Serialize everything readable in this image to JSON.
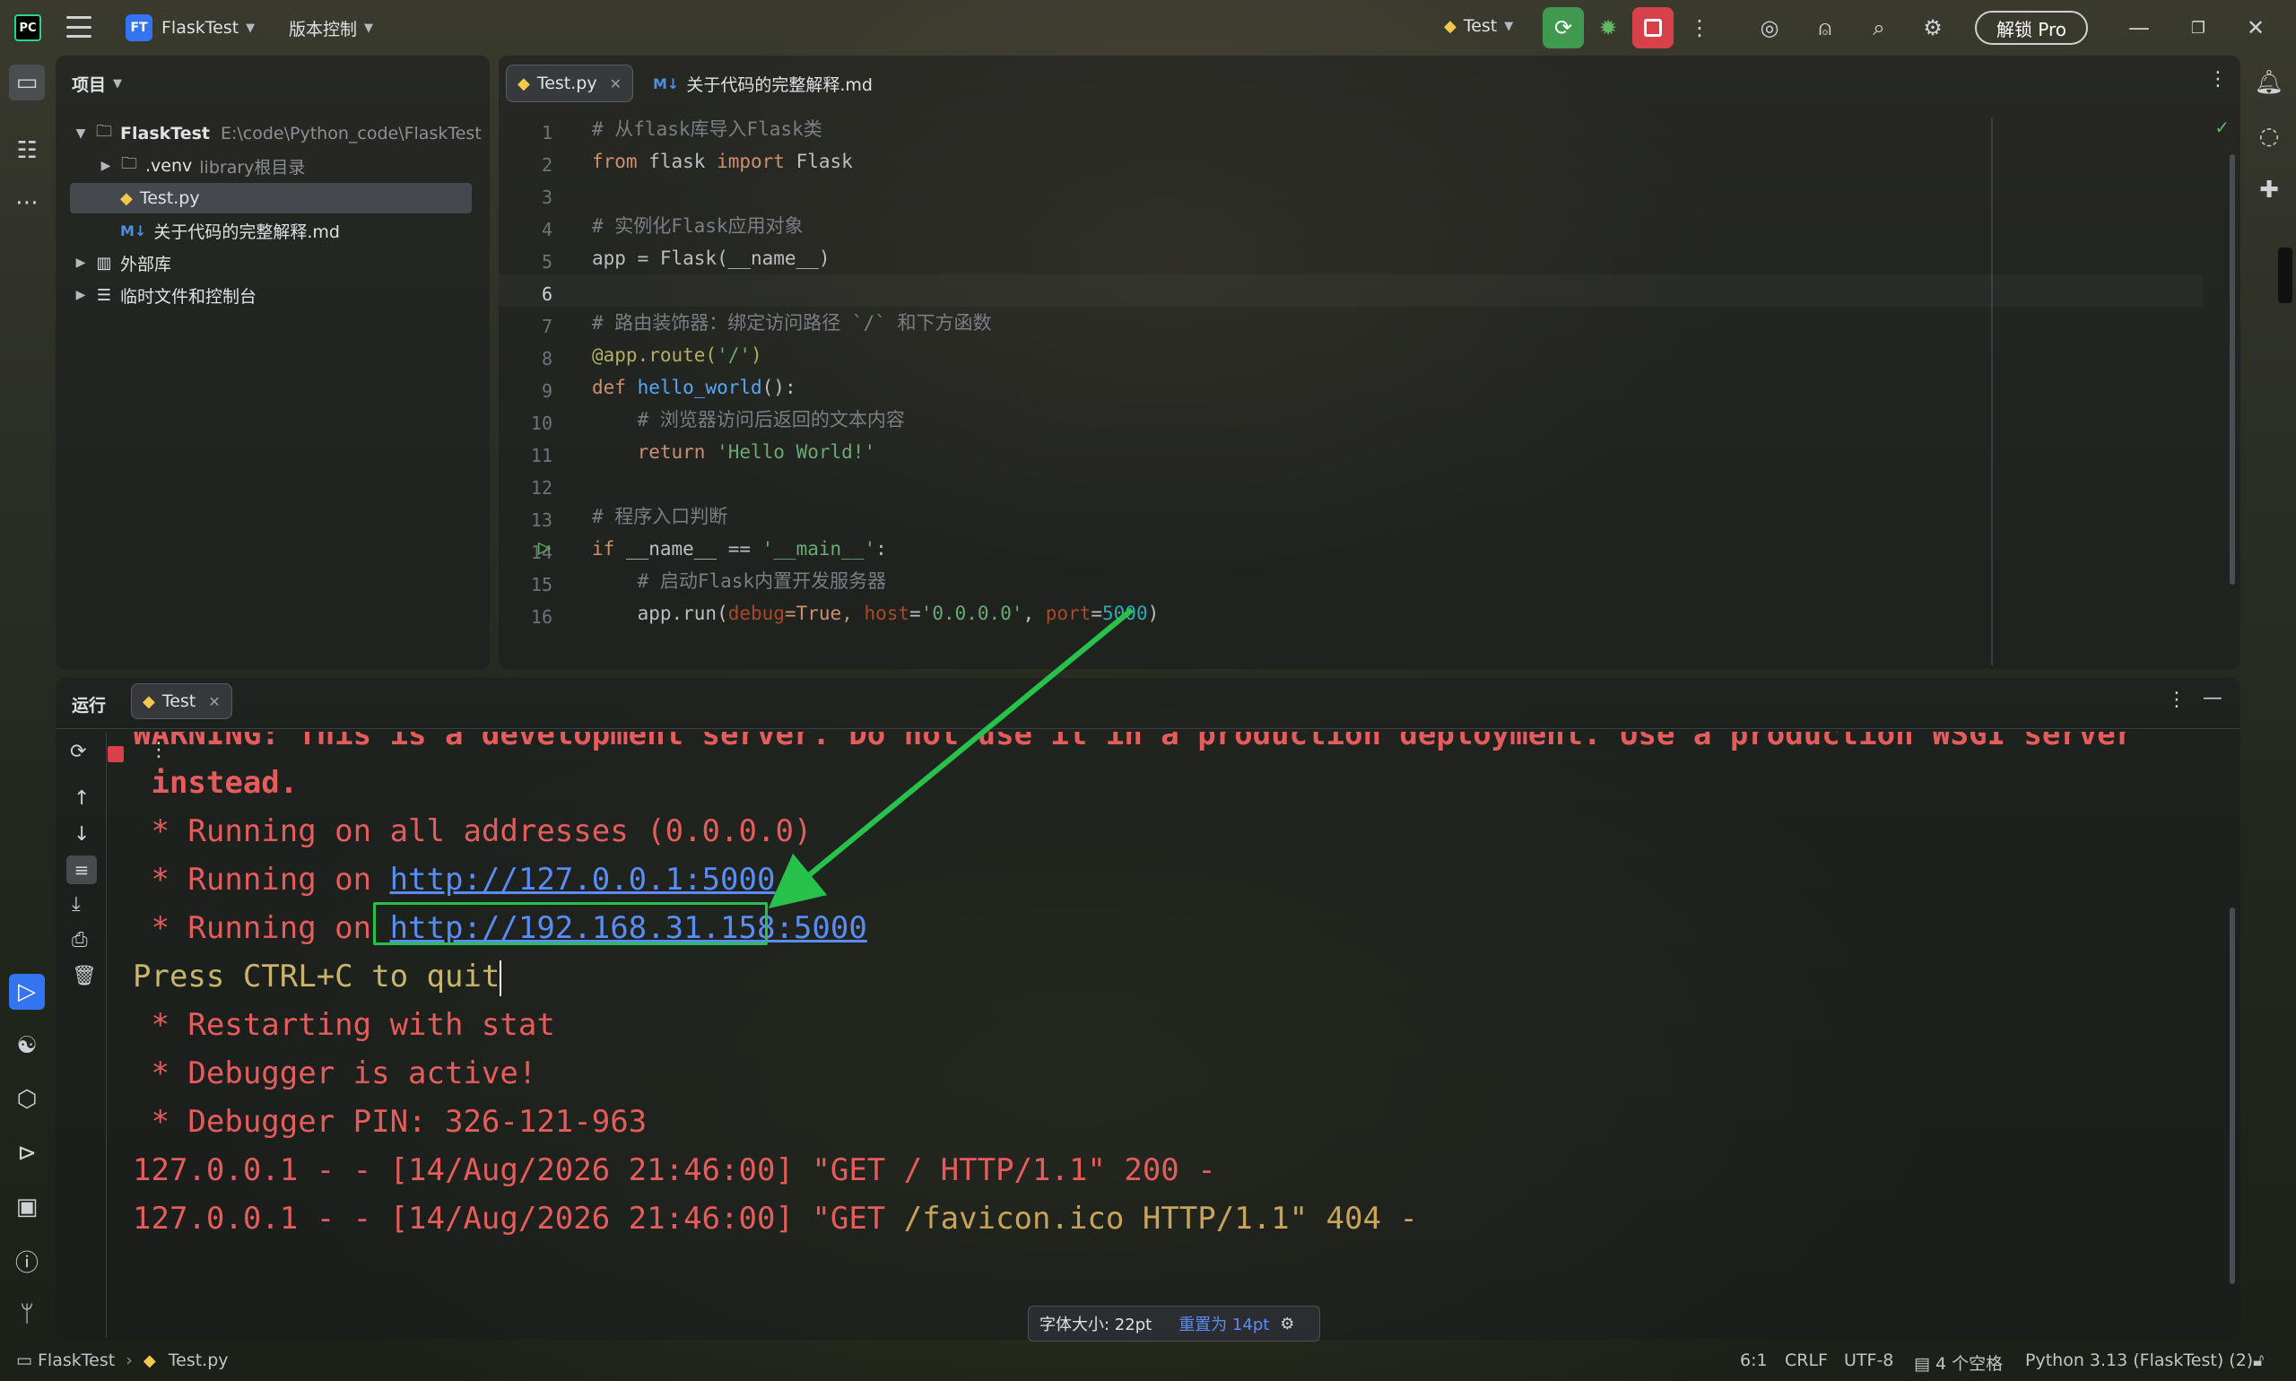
{
  "titlebar": {
    "logo": "PC",
    "project_badge": "FT",
    "project_name": "FlaskTest",
    "vcs_label": "版本控制",
    "run_config": "Test",
    "pro_button": "解锁 Pro"
  },
  "project_panel": {
    "title": "项目",
    "tree": [
      {
        "label": "FlaskTest",
        "hint": "E:\\code\\Python_code\\FlaskTest"
      },
      {
        "label": ".venv",
        "hint": "library根目录"
      },
      {
        "label": "Test.py",
        "hint": ""
      },
      {
        "label": "关于代码的完整解释.md",
        "hint": ""
      },
      {
        "label": "外部库",
        "hint": ""
      },
      {
        "label": "临时文件和控制台",
        "hint": ""
      }
    ]
  },
  "editor": {
    "tabs": [
      {
        "label": "Test.py"
      },
      {
        "label": "关于代码的完整解释.md"
      }
    ],
    "line_numbers": [
      "1",
      "2",
      "3",
      "4",
      "5",
      "6",
      "7",
      "8",
      "9",
      "10",
      "11",
      "12",
      "13",
      "14",
      "15",
      "16"
    ],
    "code": {
      "l1": "# 从flask库导入Flask类",
      "l2_kw": "from",
      "l2_mod": " flask ",
      "l2_kw2": "import",
      "l2_cls": " Flask",
      "l4": "# 实例化Flask应用对象",
      "l5": "app = Flask(__name__)",
      "l7": "# 路由装饰器：绑定访问路径 `/` 和下方函数",
      "l8_dec": "@app.route(",
      "l8_str": "'/'",
      "l8_end": ")",
      "l9_kw": "def",
      "l9_fn": " hello_world",
      "l9_end": "():",
      "l10": "    # 浏览器访问后返回的文本内容",
      "l11_kw": "    return",
      "l11_str": " 'Hello World!'",
      "l13": "# 程序入口判断",
      "l14_kw": "if",
      "l14_mid": " __name__ == ",
      "l14_str": "'__main__'",
      "l14_end": ":",
      "l15": "    # 启动Flask内置开发服务器",
      "l16_a": "    app.run(",
      "l16_p1": "debug",
      "l16_b": "=True, ",
      "l16_p2": "host",
      "l16_c": "=",
      "l16_s": "'0.0.0.0'",
      "l16_d": ", ",
      "l16_p3": "port",
      "l16_e": "=",
      "l16_n": "5000",
      "l16_f": ")"
    }
  },
  "run_panel": {
    "title": "运行",
    "tab_label": "Test",
    "console": {
      "warning_partial": "WARNING: This is a development server. Do not use it in a production deployment. Use a production WSGI server",
      "instead": " instead.",
      "l_all": " * Running on all addresses (0.0.0.0)",
      "l_run_prefix": " * Running on ",
      "link1": "http://127.0.0.1:5000",
      "link2": "http://192.168.31.158:5000",
      "quit": "Press CTRL+C to quit",
      "restart": " * Restarting with stat",
      "debugger": " * Debugger is active!",
      "pin": " * Debugger PIN: 326-121-963",
      "req1": "127.0.0.1 - - [14/Aug/2026 21:46:00] \"GET / HTTP/1.1\" 200 -",
      "req2_a": "127.0.0.1 - - [14/Aug/2026 21:46:00] \"GET ",
      "req2_b": "/favicon.ico HTTP/1.1\" 404 -"
    }
  },
  "font_popup": {
    "size_label": "字体大小: 22pt",
    "reset_label": "重置为 14pt"
  },
  "statusbar": {
    "breadcrumb_project": "FlaskTest",
    "breadcrumb_file": "Test.py",
    "position": "6:1",
    "line_ending": "CRLF",
    "encoding": "UTF-8",
    "indent": "4 个空格",
    "interpreter": "Python 3.13 (FlaskTest) (2)"
  },
  "colors": {
    "accent_blue": "#3574f0",
    "highlight_green": "#27c24c",
    "console_red": "#e55c5c",
    "link_blue": "#5a8cf5"
  }
}
